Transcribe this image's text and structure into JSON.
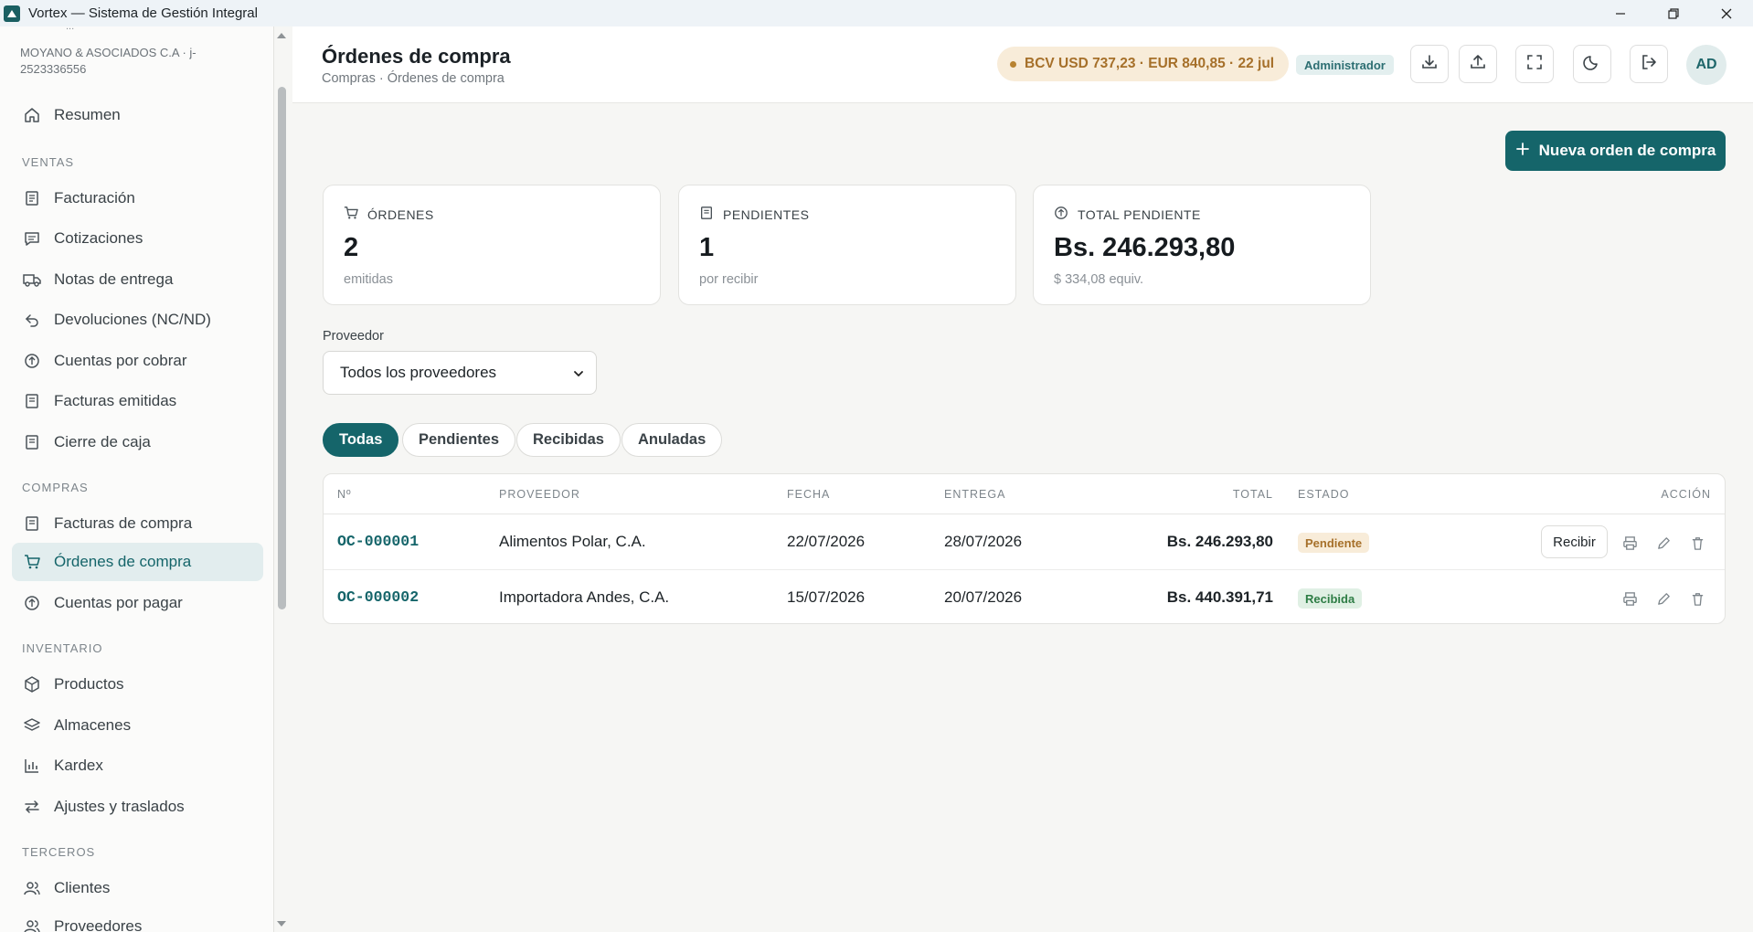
{
  "window": {
    "title": "Vortex — Sistema de Gestión Integral"
  },
  "sidebar": {
    "company_top": "...",
    "company": "MOYANO & ASOCIADOS C.A · j-2523336556",
    "items": {
      "resumen": "Resumen",
      "facturacion": "Facturación",
      "cotizaciones": "Cotizaciones",
      "notas_entrega": "Notas de entrega",
      "devoluciones": "Devoluciones (NC/ND)",
      "cuentas_cobrar": "Cuentas por cobrar",
      "facturas_emitidas": "Facturas emitidas",
      "cierre_caja": "Cierre de caja",
      "facturas_compra": "Facturas de compra",
      "ordenes_compra": "Órdenes de compra",
      "cuentas_pagar": "Cuentas por pagar",
      "productos": "Productos",
      "almacenes": "Almacenes",
      "kardex": "Kardex",
      "ajustes": "Ajustes y traslados",
      "clientes": "Clientes",
      "proveedores": "Proveedores"
    },
    "sections": {
      "ventas": "VENTAS",
      "compras": "COMPRAS",
      "inventario": "INVENTARIO",
      "terceros": "TERCEROS"
    }
  },
  "header": {
    "title": "Órdenes de compra",
    "breadcrumb": "Compras · Órdenes de compra",
    "rate": "BCV USD 737,23 · EUR 840,85 · 22 jul",
    "role": "Administrador",
    "avatar": "AD"
  },
  "main": {
    "new_button": "Nueva orden de compra",
    "cards": {
      "ordenes": {
        "label": "ÓRDENES",
        "value": "2",
        "sub": "emitidas"
      },
      "pendientes": {
        "label": "PENDIENTES",
        "value": "1",
        "sub": "por recibir"
      },
      "total": {
        "label": "TOTAL PENDIENTE",
        "value": "Bs. 246.293,80",
        "sub": "$ 334,08 equiv."
      }
    },
    "filter": {
      "label": "Proveedor",
      "selected": "Todos los proveedores"
    },
    "tabs": {
      "todas": "Todas",
      "pendientes": "Pendientes",
      "recibidas": "Recibidas",
      "anuladas": "Anuladas"
    },
    "table": {
      "headers": {
        "num": "Nº",
        "proveedor": "PROVEEDOR",
        "fecha": "FECHA",
        "entrega": "ENTREGA",
        "total": "TOTAL",
        "estado": "ESTADO",
        "accion": "ACCIÓN"
      },
      "rows": [
        {
          "num": "OC-000001",
          "proveedor": "Alimentos Polar, C.A.",
          "fecha": "22/07/2026",
          "entrega": "28/07/2026",
          "total": "Bs. 246.293,80",
          "estado": "Pendiente",
          "action": "Recibir"
        },
        {
          "num": "OC-000002",
          "proveedor": "Importadora Andes, C.A.",
          "fecha": "15/07/2026",
          "entrega": "20/07/2026",
          "total": "Bs. 440.391,71",
          "estado": "Recibida"
        }
      ]
    }
  },
  "colors": {
    "accent": "#15656a",
    "pending": "#a6702a",
    "received": "#2e7d45"
  }
}
